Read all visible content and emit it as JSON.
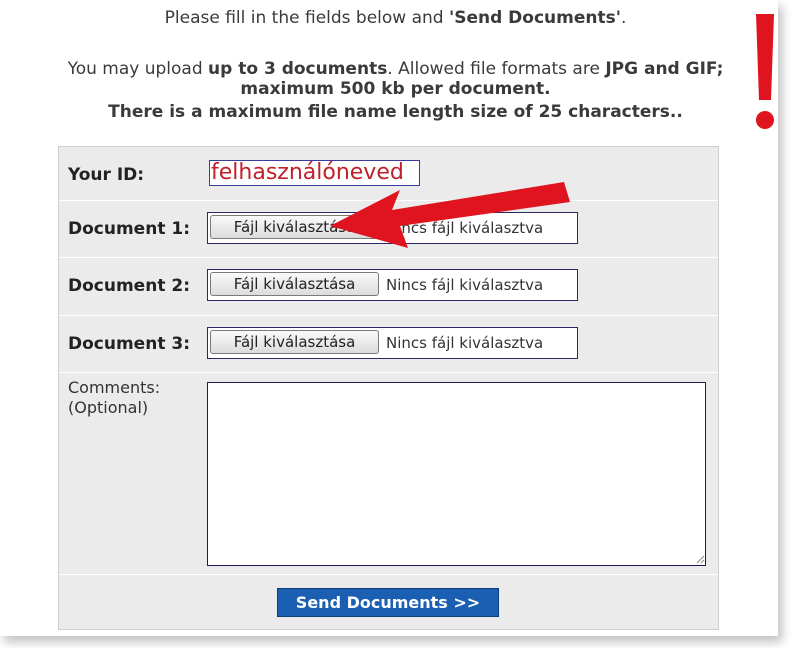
{
  "intro": {
    "line1_pre": "Please fill in the fields below and ",
    "line1_bold": "'Send Documents'",
    "line1_post": ".",
    "line2_pre": "You may upload ",
    "line2_bold1": "up to 3 documents",
    "line2_mid": ". Allowed file formats are ",
    "line2_bold2": "JPG and GIF;",
    "line3": "maximum 500 kb per document.",
    "line4": "There is a maximum file name length size of 25 characters.."
  },
  "form": {
    "your_id_label": "Your ID:",
    "your_id_value": "felhasználóneved",
    "documents": [
      {
        "label": "Document 1:",
        "button": "Fájl kiválasztása",
        "status": "Nincs fájl kiválasztva"
      },
      {
        "label": "Document 2:",
        "button": "Fájl kiválasztása",
        "status": "Nincs fájl kiválasztva"
      },
      {
        "label": "Document 3:",
        "button": "Fájl kiválasztása",
        "status": "Nincs fájl kiválasztva"
      }
    ],
    "comments_label_line1": "Comments:",
    "comments_label_line2": "(Optional)",
    "comments_value": "",
    "submit_label": "Send Documents >>"
  },
  "colors": {
    "annotation_red": "#e0141e",
    "submit_blue": "#1b5fb3",
    "form_bg": "#ebebeb",
    "id_text": "#c0202a"
  },
  "annotations": {
    "arrow": "red-arrow-icon",
    "exclamation": "exclamation-icon"
  }
}
